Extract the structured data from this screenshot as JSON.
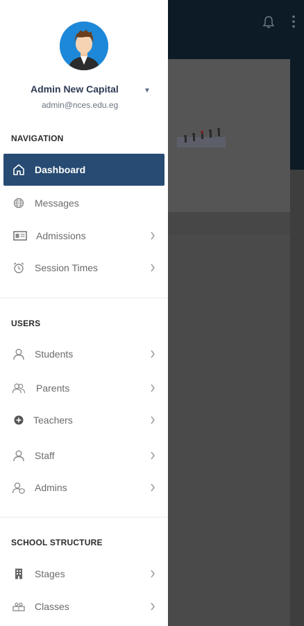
{
  "user": {
    "name": "Admin New Capital",
    "email": "admin@nces.edu.eg"
  },
  "sections": [
    {
      "title": "NAVIGATION",
      "items": [
        {
          "label": "Dashboard",
          "icon": "home-icon",
          "active": true,
          "has_chevron": false
        },
        {
          "label": "Messages",
          "icon": "globe-icon",
          "active": false,
          "has_chevron": false
        },
        {
          "label": "Admissions",
          "icon": "id-card-icon",
          "active": false,
          "has_chevron": true
        },
        {
          "label": "Session Times",
          "icon": "alarm-clock-icon",
          "active": false,
          "has_chevron": true
        }
      ]
    },
    {
      "title": "USERS",
      "items": [
        {
          "label": "Students",
          "icon": "user-icon",
          "active": false,
          "has_chevron": true
        },
        {
          "label": "Parents",
          "icon": "users-icon",
          "active": false,
          "has_chevron": true
        },
        {
          "label": "Teachers",
          "icon": "plus-circle-icon",
          "active": false,
          "has_chevron": true
        },
        {
          "label": "Staff",
          "icon": "user-icon",
          "active": false,
          "has_chevron": true
        },
        {
          "label": "Admins",
          "icon": "user-shield-icon",
          "active": false,
          "has_chevron": true
        }
      ]
    },
    {
      "title": "SCHOOL STRUCTURE",
      "items": [
        {
          "label": "Stages",
          "icon": "building-icon",
          "active": false,
          "has_chevron": true
        },
        {
          "label": "Classes",
          "icon": "classroom-icon",
          "active": false,
          "has_chevron": true
        }
      ]
    }
  ],
  "colors": {
    "active_bg": "#274b72",
    "avatar_bg": "#1e88d8",
    "overlay": "#474747",
    "header_dark": "#0d1b26"
  }
}
